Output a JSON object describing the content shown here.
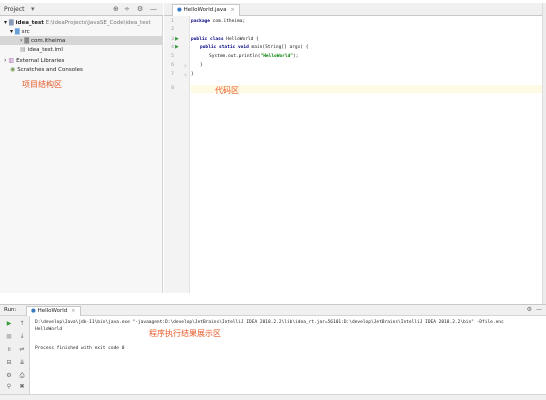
{
  "project_panel": {
    "title": "Project",
    "tree": [
      {
        "label": "idea_test",
        "path": "E:\\IdeaProjects\\JavaSE_Code\\idea_test"
      },
      {
        "label": "src"
      },
      {
        "label": "com.itheima"
      },
      {
        "label": "idea_test.iml"
      },
      {
        "label": "External Libraries"
      },
      {
        "label": "Scratches and Consoles"
      }
    ],
    "annotation": "项目结构区"
  },
  "editor": {
    "tab_label": "HelloWorld.java",
    "line_numbers": [
      "1",
      "2",
      "3",
      "4",
      "5",
      "6",
      "7",
      "8"
    ],
    "code": {
      "line1": {
        "keyword": "package",
        "rest": " com.itheima;"
      },
      "line3": {
        "kw1": "public",
        "kw2": "class",
        "rest": " HelloWorld {"
      },
      "line4": {
        "kw1": "public",
        "kw2": "static",
        "kw3": "void",
        "rest": " main(String[] args) {"
      },
      "line5": {
        "pre": "System.out.println(",
        "str": "\"HelloWorld\"",
        "post": ");"
      },
      "line6": "}",
      "line7": "}"
    },
    "annotation": "代码区"
  },
  "run_panel": {
    "label": "Run:",
    "tab_label": "HelloWorld",
    "console": [
      "D:\\develop\\Java\\jdk-11\\bin\\java.exe \"-javaagent:D:\\develop\\JetBrains\\IntelliJ IDEA 2018.2.2\\lib\\idea_rt.jar=56101:D:\\develop\\JetBrains\\IntelliJ IDEA 2018.2.2\\bin\" -Dfile.enc",
      "HelloWorld",
      "Process finished with exit code 0"
    ],
    "annotation": "程序执行结果展示区"
  },
  "colors": {
    "annotation": "#e65a2a",
    "keyword": "#000080",
    "string": "#008000",
    "run_arrow": "#3a9a3a"
  }
}
